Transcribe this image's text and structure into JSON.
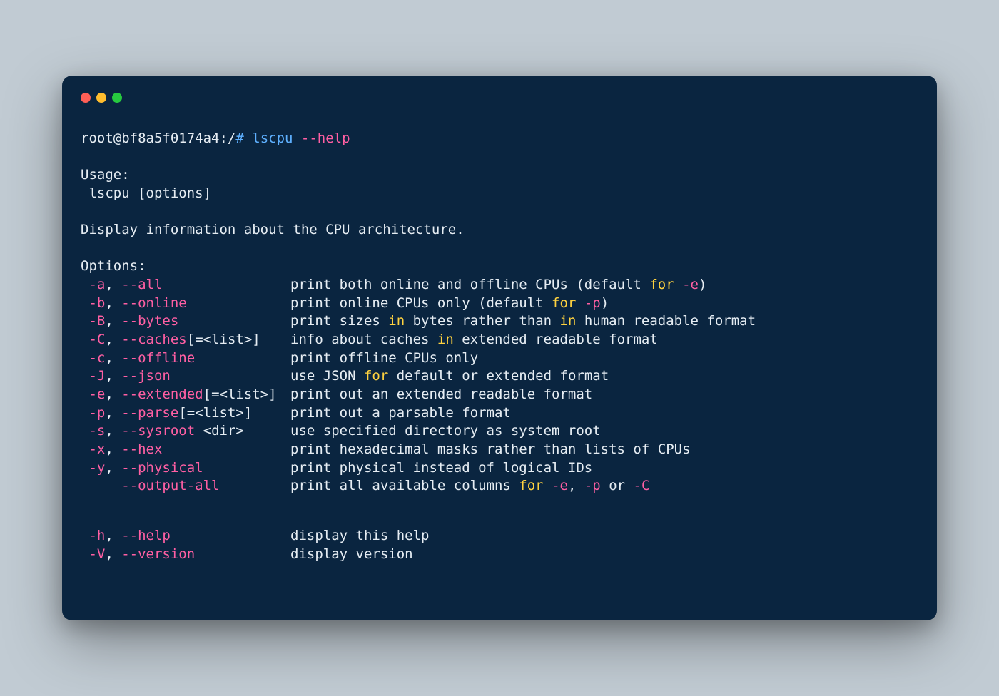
{
  "prompt": {
    "user_host_path": "root@bf8a5f0174a4:/",
    "hash": "#",
    "command": "lscpu",
    "flag": "--help"
  },
  "output": {
    "usage_header": "Usage:",
    "usage_line": " lscpu [options]",
    "description": "Display information about the CPU architecture.",
    "options_header": "Options:",
    "options": [
      {
        "short": "-a",
        "long": "--all",
        "arg": "",
        "desc_segments": [
          {
            "t": "print both online and offline CPUs (default "
          },
          {
            "kw": "for"
          },
          {
            "t": " "
          },
          {
            "opt": "-e"
          },
          {
            "t": ")"
          }
        ]
      },
      {
        "short": "-b",
        "long": "--online",
        "arg": "",
        "desc_segments": [
          {
            "t": "print online CPUs only (default "
          },
          {
            "kw": "for"
          },
          {
            "t": " "
          },
          {
            "opt": "-p"
          },
          {
            "t": ")"
          }
        ]
      },
      {
        "short": "-B",
        "long": "--bytes",
        "arg": "",
        "desc_segments": [
          {
            "t": "print sizes "
          },
          {
            "kw": "in"
          },
          {
            "t": " bytes rather than "
          },
          {
            "kw": "in"
          },
          {
            "t": " human readable format"
          }
        ]
      },
      {
        "short": "-C",
        "long": "--caches",
        "arg": "[=<list>]",
        "desc_segments": [
          {
            "t": "info about caches "
          },
          {
            "kw": "in"
          },
          {
            "t": " extended readable format"
          }
        ]
      },
      {
        "short": "-c",
        "long": "--offline",
        "arg": "",
        "desc_segments": [
          {
            "t": "print offline CPUs only"
          }
        ]
      },
      {
        "short": "-J",
        "long": "--json",
        "arg": "",
        "desc_segments": [
          {
            "t": "use JSON "
          },
          {
            "kw": "for"
          },
          {
            "t": " default or extended format"
          }
        ]
      },
      {
        "short": "-e",
        "long": "--extended",
        "arg": "[=<list>]",
        "desc_segments": [
          {
            "t": "print out an extended readable format"
          }
        ]
      },
      {
        "short": "-p",
        "long": "--parse",
        "arg": "[=<list>]",
        "desc_segments": [
          {
            "t": "print out a parsable format"
          }
        ]
      },
      {
        "short": "-s",
        "long": "--sysroot",
        "arg": " <dir>",
        "desc_segments": [
          {
            "t": "use specified directory as system root"
          }
        ]
      },
      {
        "short": "-x",
        "long": "--hex",
        "arg": "",
        "desc_segments": [
          {
            "t": "print hexadecimal masks rather than lists of CPUs"
          }
        ]
      },
      {
        "short": "-y",
        "long": "--physical",
        "arg": "",
        "desc_segments": [
          {
            "t": "print physical instead of logical IDs"
          }
        ]
      },
      {
        "short": "",
        "long": "--output-all",
        "arg": "",
        "desc_segments": [
          {
            "t": "print all available columns "
          },
          {
            "kw": "for"
          },
          {
            "t": " "
          },
          {
            "opt": "-e"
          },
          {
            "t": ", "
          },
          {
            "opt": "-p"
          },
          {
            "t": " or "
          },
          {
            "opt": "-C"
          }
        ]
      }
    ],
    "options2": [
      {
        "short": "-h",
        "long": "--help",
        "arg": "",
        "desc_segments": [
          {
            "t": "display this help"
          }
        ]
      },
      {
        "short": "-V",
        "long": "--version",
        "arg": "",
        "desc_segments": [
          {
            "t": "display version"
          }
        ]
      }
    ]
  }
}
